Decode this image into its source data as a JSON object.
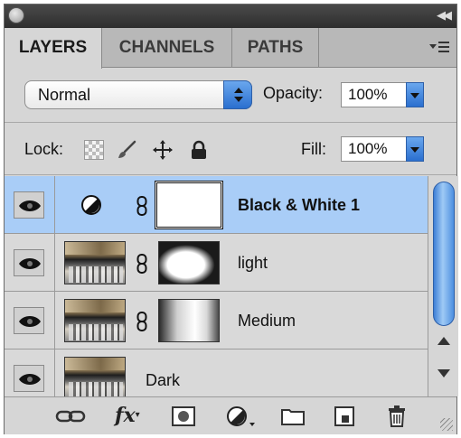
{
  "panel": {
    "tabs": [
      {
        "label": "LAYERS",
        "active": true
      },
      {
        "label": "CHANNELS",
        "active": false
      },
      {
        "label": "PATHS",
        "active": false
      }
    ]
  },
  "blend_mode": {
    "value": "Normal"
  },
  "opacity": {
    "label": "Opacity:",
    "value": "100%"
  },
  "lock": {
    "label": "Lock:",
    "icons": [
      "lock-transparent-icon",
      "brush-icon",
      "move-icon",
      "padlock-icon"
    ]
  },
  "fill": {
    "label": "Fill:",
    "value": "100%"
  },
  "layers": [
    {
      "name": "Black & White 1",
      "selected": true,
      "visible": true,
      "type": "adjustment"
    },
    {
      "name": "light",
      "selected": false,
      "visible": true,
      "type": "image-with-mask"
    },
    {
      "name": "Medium",
      "selected": false,
      "visible": true,
      "type": "image-with-mask"
    },
    {
      "name": "Dark",
      "selected": false,
      "visible": true,
      "type": "image"
    }
  ],
  "bottom_bar": {
    "icons": [
      "link-layers-icon",
      "fx-icon",
      "add-mask-icon",
      "adjustment-layer-icon",
      "new-group-icon",
      "new-layer-icon",
      "trash-icon"
    ],
    "fx_label": "fx"
  },
  "colors": {
    "selected_row": "#a9cdf7",
    "accent_blue": "#2a6fcf"
  }
}
